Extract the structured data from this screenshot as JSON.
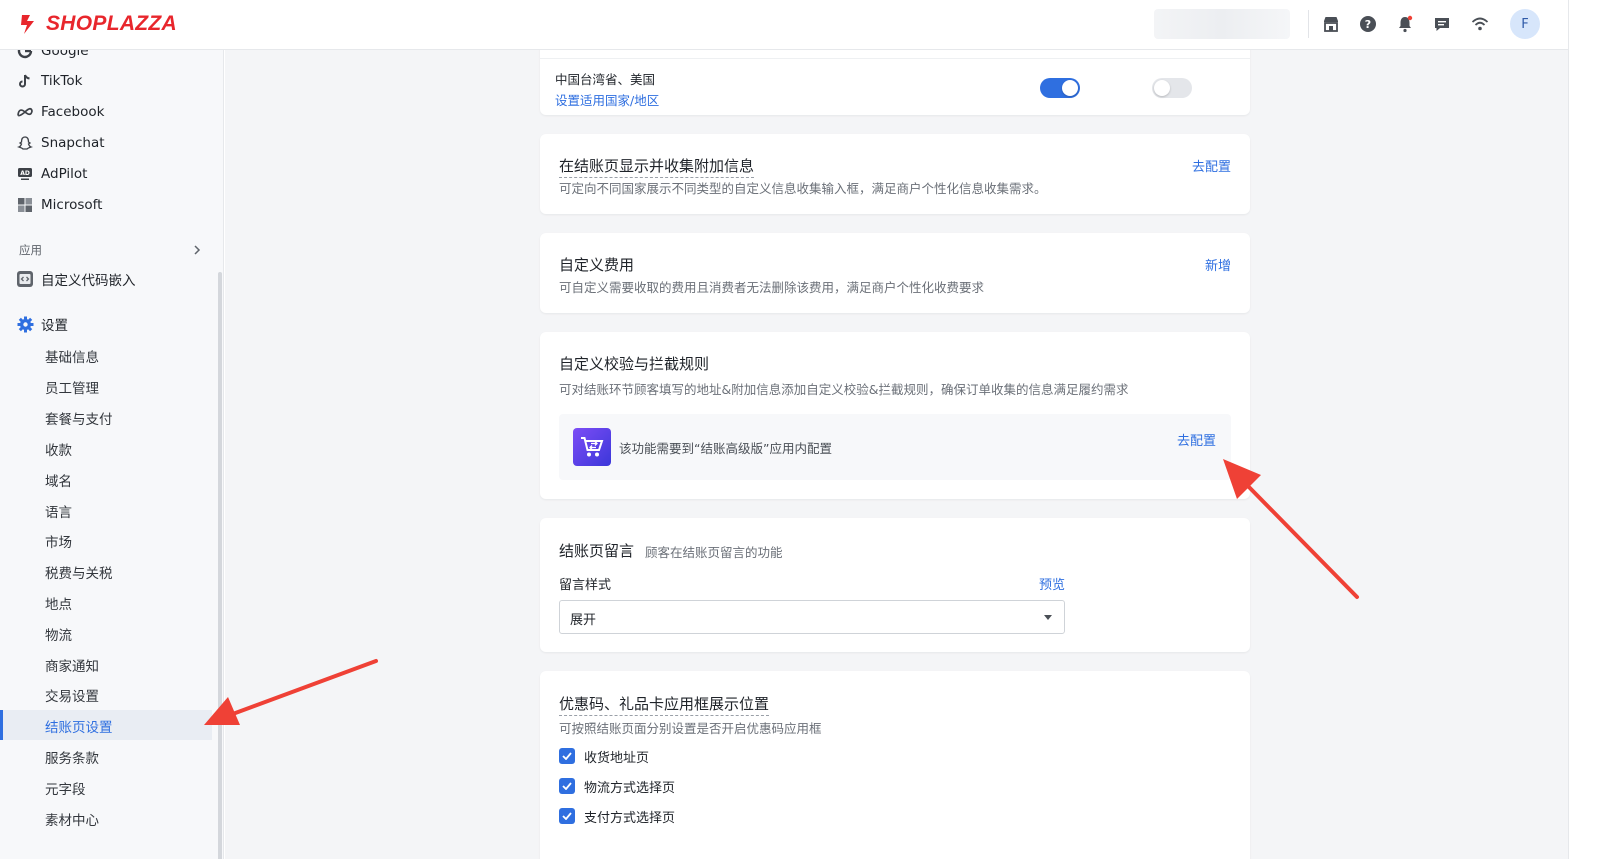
{
  "header": {
    "brand": "SHOPLAZZA",
    "icons": [
      "store-icon",
      "help-icon",
      "bell-icon",
      "message-icon",
      "wifi-icon"
    ],
    "avatar_initial": "F"
  },
  "sidebar": {
    "channels": [
      {
        "label": "Google",
        "icon": "google-icon"
      },
      {
        "label": "TikTok",
        "icon": "tiktok-icon"
      },
      {
        "label": "Facebook",
        "icon": "meta-icon"
      },
      {
        "label": "Snapchat",
        "icon": "snapchat-icon"
      },
      {
        "label": "AdPilot",
        "icon": "ad-icon"
      },
      {
        "label": "Microsoft",
        "icon": "microsoft-icon"
      }
    ],
    "apps_section": "应用",
    "apps": [
      {
        "label": "自定义代码嵌入",
        "icon": "code-embed-icon"
      }
    ],
    "settings_label": "设置",
    "settings_items": [
      "基础信息",
      "员工管理",
      "套餐与支付",
      "收款",
      "域名",
      "语言",
      "市场",
      "税费与关税",
      "地点",
      "物流",
      "商家通知",
      "交易设置",
      "结账页设置",
      "服务条款",
      "元字段",
      "素材中心"
    ],
    "active_item": "结账页设置"
  },
  "main": {
    "top_card": {
      "regions": "中国台湾省、美国",
      "region_link": "设置适用国家/地区",
      "toggle_1_on": true,
      "toggle_2_on": false
    },
    "additional_info": {
      "title": "在结账页显示并收集附加信息",
      "desc": "可定向不同国家展示不同类型的自定义信息收集输入框，满足商户个性化信息收集需求。",
      "action": "去配置"
    },
    "custom_fee": {
      "title": "自定义费用",
      "desc": "可自定义需要收取的费用且消费者无法删除该费用，满足商户个性化收费要求",
      "action": "新增"
    },
    "validation": {
      "title": "自定义校验与拦截规则",
      "desc": "可对结账环节顾客填写的地址&附加信息添加自定义校验&拦截规则，确保订单收集的信息满足履约需求",
      "notice": "该功能需要到“结账高级版”应用内配置",
      "action": "去配置"
    },
    "checkout_message": {
      "title": "结账页留言",
      "subtitle": "顾客在结账页留言的功能",
      "field_label": "留言样式",
      "preview": "预览",
      "selected": "展开"
    },
    "coupon": {
      "title": "优惠码、礼品卡应用框展示位置",
      "desc": "可按照结账页面分别设置是否开启优惠码应用框",
      "options": [
        {
          "label": "收货地址页",
          "checked": true
        },
        {
          "label": "物流方式选择页",
          "checked": true
        },
        {
          "label": "支付方式选择页",
          "checked": true
        }
      ]
    }
  },
  "colors": {
    "accent": "#2f6fe0",
    "brand": "#e8262c",
    "annotation_arrow": "#ef4136"
  }
}
